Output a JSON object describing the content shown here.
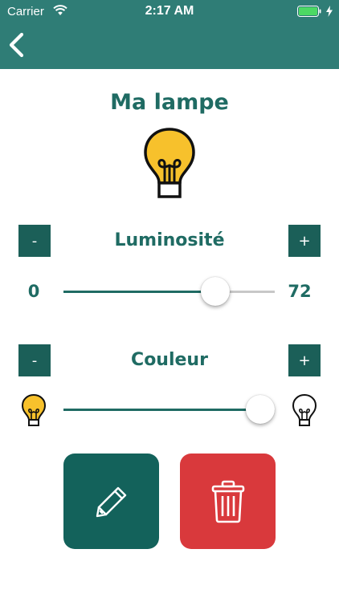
{
  "status_bar": {
    "carrier": "Carrier",
    "time": "2:17 AM"
  },
  "header": {
    "back_icon": "chevron-left-icon",
    "background_color": "#2f7d76"
  },
  "lamp": {
    "name": "Ma lampe",
    "icon": "light-bulb-on-icon",
    "bulb_color": "#f7c12c"
  },
  "brightness": {
    "label": "Luminosité",
    "decrement_label": "-",
    "increment_label": "+",
    "min_label": "0",
    "value_label": "72",
    "level_fraction": 0.72
  },
  "color": {
    "label": "Couleur",
    "decrement_label": "-",
    "increment_label": "+",
    "warm_icon": "light-bulb-yellow-icon",
    "cold_icon": "light-bulb-outline-icon",
    "level_fraction": 0.93
  },
  "actions": {
    "edit_icon": "pencil-icon",
    "delete_icon": "trash-icon",
    "edit_color": "#13625b",
    "delete_color": "#d9393c"
  }
}
